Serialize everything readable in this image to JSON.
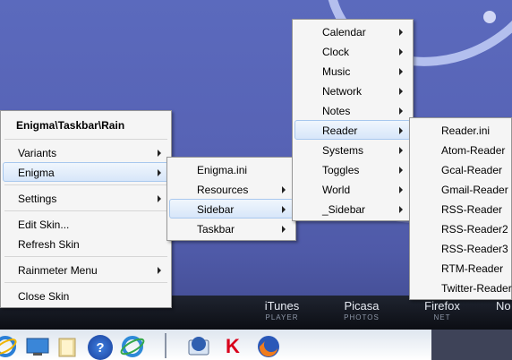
{
  "context_menu": {
    "header": "Enigma\\Taskbar\\Rain",
    "items": [
      {
        "label": "Variants"
      },
      {
        "label": "Enigma"
      },
      {
        "label": "Settings"
      },
      {
        "label": "Edit Skin..."
      },
      {
        "label": "Refresh Skin"
      },
      {
        "label": "Rainmeter Menu"
      },
      {
        "label": "Close Skin"
      }
    ]
  },
  "enigma_menu": {
    "items": [
      {
        "label": "Enigma.ini"
      },
      {
        "label": "Resources"
      },
      {
        "label": "Sidebar"
      },
      {
        "label": "Taskbar"
      }
    ]
  },
  "sidebar_menu": {
    "items": [
      {
        "label": "Calendar"
      },
      {
        "label": "Clock"
      },
      {
        "label": "Music"
      },
      {
        "label": "Network"
      },
      {
        "label": "Notes"
      },
      {
        "label": "Reader"
      },
      {
        "label": "Systems"
      },
      {
        "label": "Toggles"
      },
      {
        "label": "World"
      },
      {
        "label": "_Sidebar"
      }
    ]
  },
  "reader_menu": {
    "items": [
      {
        "label": "Reader.ini"
      },
      {
        "label": "Atom-Reader"
      },
      {
        "label": "Gcal-Reader"
      },
      {
        "label": "Gmail-Reader"
      },
      {
        "label": "RSS-Reader"
      },
      {
        "label": "RSS-Reader2"
      },
      {
        "label": "RSS-Reader3"
      },
      {
        "label": "RTM-Reader"
      },
      {
        "label": "Twitter-Reader"
      }
    ]
  },
  "skin_bar": {
    "items": [
      {
        "title": "iTunes",
        "subtitle": "PLAYER"
      },
      {
        "title": "Picasa",
        "subtitle": "PHOTOS"
      },
      {
        "title": "Firefox",
        "subtitle": "NET"
      },
      {
        "title": "No",
        "subtitle": ""
      }
    ]
  },
  "taskbar": {
    "icons": [
      {
        "icon": "internet-explorer-icon"
      },
      {
        "icon": "show-desktop-icon"
      },
      {
        "icon": "folder-icon"
      },
      {
        "icon": "help-icon",
        "glyph": "?"
      },
      {
        "icon": "ie-alt-icon"
      },
      {
        "icon": "thunderbird-icon"
      },
      {
        "icon": "kaspersky-icon",
        "glyph": "K"
      },
      {
        "icon": "firefox-icon"
      }
    ]
  },
  "colors": {
    "desktop": "#5763b5",
    "menu_background": "#f5f5f5",
    "menu_highlight": "#d7e6f9",
    "skin_bar": "#0c0e14"
  }
}
